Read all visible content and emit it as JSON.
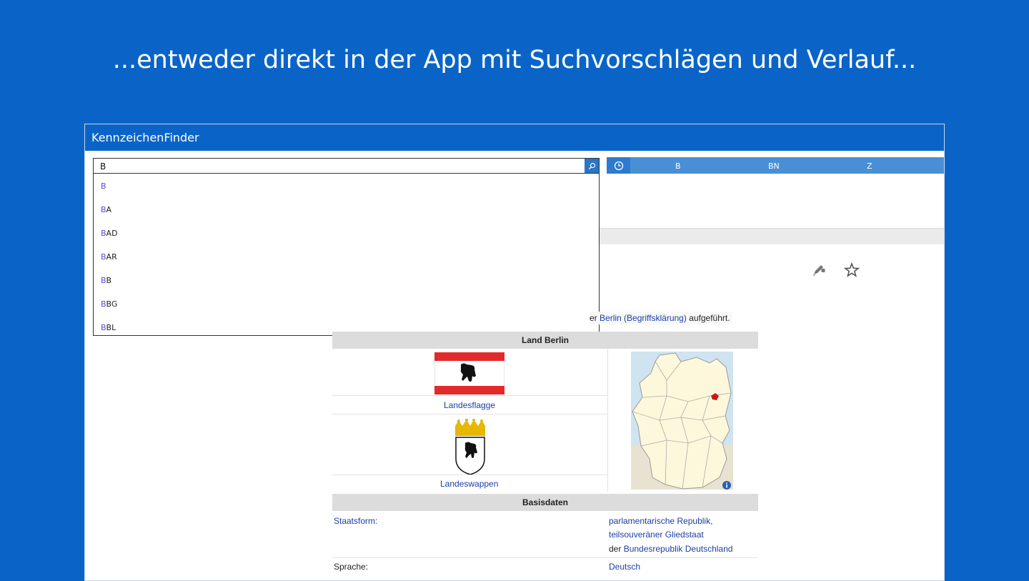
{
  "caption": "...entweder direkt in der App mit Suchvorschlägen und Verlauf...",
  "app": {
    "title": "KennzeichenFinder"
  },
  "search": {
    "value": "B",
    "suggestions": [
      {
        "match": "B",
        "rest": ""
      },
      {
        "match": "B",
        "rest": "A"
      },
      {
        "match": "B",
        "rest": "AD"
      },
      {
        "match": "B",
        "rest": "AR"
      },
      {
        "match": "B",
        "rest": "B"
      },
      {
        "match": "B",
        "rest": "BG"
      },
      {
        "match": "B",
        "rest": "BL"
      }
    ]
  },
  "history": {
    "items": [
      "B",
      "BN",
      "Z"
    ]
  },
  "article": {
    "intro_prefix": "er ",
    "intro_link": "Berlin (Begriffsklärung)",
    "intro_suffix": " aufgeführt."
  },
  "infobox": {
    "title": "Land Berlin",
    "flag_caption": "Landesflagge",
    "coat_caption": "Landeswappen",
    "section_basis": "Basisdaten",
    "staatsform_label": "Staatsform:",
    "staatsform_line1": "parlamentarische Republik,",
    "staatsform_line2": "teilsouveräner Gliedstaat",
    "staatsform_line3_prefix": "der ",
    "staatsform_line3_link": "Bundesrepublik Deutschland",
    "sprache_label": "Sprache:",
    "sprache_value": "Deutsch"
  },
  "colors": {
    "background": "#0a64c8",
    "accent": "#4a8fd6",
    "link": "#1a3ea8",
    "match": "#5a4ad0"
  },
  "icons": [
    "search-icon",
    "clock-icon",
    "edit-icon",
    "star-icon",
    "info-icon"
  ]
}
